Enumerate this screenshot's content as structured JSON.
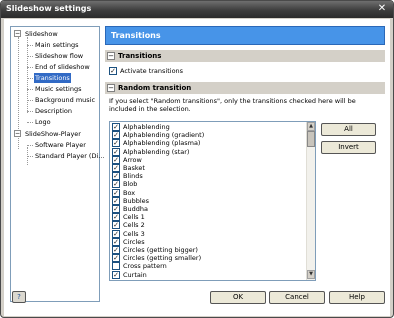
{
  "window": {
    "title": "Slideshow settings",
    "close": "✕"
  },
  "tree": {
    "items": [
      {
        "label": "Slideshow",
        "expander": "−"
      },
      {
        "label": "Main settings"
      },
      {
        "label": "Slideshow flow"
      },
      {
        "label": "End of slideshow"
      },
      {
        "label": "Transitions",
        "selected": true
      },
      {
        "label": "Music settings"
      },
      {
        "label": "Background music"
      },
      {
        "label": "Description"
      },
      {
        "label": "Logo"
      },
      {
        "label": "SlideShow-Player",
        "expander": "−"
      },
      {
        "label": "Software Player"
      },
      {
        "label": "Standard Player (Di..."
      }
    ]
  },
  "banner": {
    "title": "Transitions"
  },
  "sections": {
    "transitions": {
      "label": "Transitions",
      "toggle": "−"
    },
    "random": {
      "label": "Random transition",
      "toggle": "−"
    }
  },
  "activate": {
    "label": "Activate transitions",
    "checked": true
  },
  "info": "If you select \"Random transitions\", only the transitions checked here will be included in the selection.",
  "transitions_list": [
    {
      "label": "Alphablending",
      "checked": true
    },
    {
      "label": "Alphablending (gradient)",
      "checked": true
    },
    {
      "label": "Alphablending (plasma)",
      "checked": true
    },
    {
      "label": "Alphablending (star)",
      "checked": true
    },
    {
      "label": "Arrow",
      "checked": true
    },
    {
      "label": "Basket",
      "checked": true
    },
    {
      "label": "Blinds",
      "checked": true
    },
    {
      "label": "Blob",
      "checked": true
    },
    {
      "label": "Box",
      "checked": true
    },
    {
      "label": "Bubbles",
      "checked": true
    },
    {
      "label": "Buddha",
      "checked": true
    },
    {
      "label": "Cells 1",
      "checked": true
    },
    {
      "label": "Cells 2",
      "checked": true
    },
    {
      "label": "Cells 3",
      "checked": true
    },
    {
      "label": "Circles",
      "checked": true
    },
    {
      "label": "Circles (getting bigger)",
      "checked": true
    },
    {
      "label": "Circles (getting smaller)",
      "checked": true
    },
    {
      "label": "Cross pattern",
      "checked": false
    },
    {
      "label": "Curtain",
      "checked": true
    }
  ],
  "buttons": {
    "all": "All",
    "invert": "Invert",
    "ok": "OK",
    "cancel": "Cancel",
    "help": "Help"
  },
  "colors": {
    "accent": "#4794e8",
    "selection": "#316ac5"
  }
}
